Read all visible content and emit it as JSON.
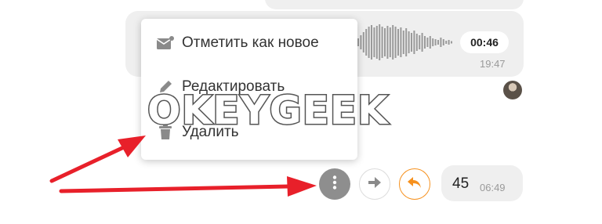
{
  "voice_message": {
    "duration": "00:46",
    "time": "19:47"
  },
  "context_menu": {
    "items": [
      {
        "label": "Отметить как новое",
        "icon": "mark-unread-icon"
      },
      {
        "label": "Редактировать",
        "icon": "pencil-icon"
      },
      {
        "label": "Удалить",
        "icon": "trash-icon"
      }
    ]
  },
  "message": {
    "text": "45",
    "time": "06:49"
  },
  "actions": {
    "more_icon": "more-vertical-icon",
    "forward_icon": "forward-arrow-icon",
    "reply_icon": "reply-icon"
  },
  "watermark": "OKEYGEEK",
  "colors": {
    "bubble": "#efefef",
    "accent_orange": "#f6911e",
    "annotation_red": "#e8202a",
    "more_button": "#8e8e8e"
  }
}
